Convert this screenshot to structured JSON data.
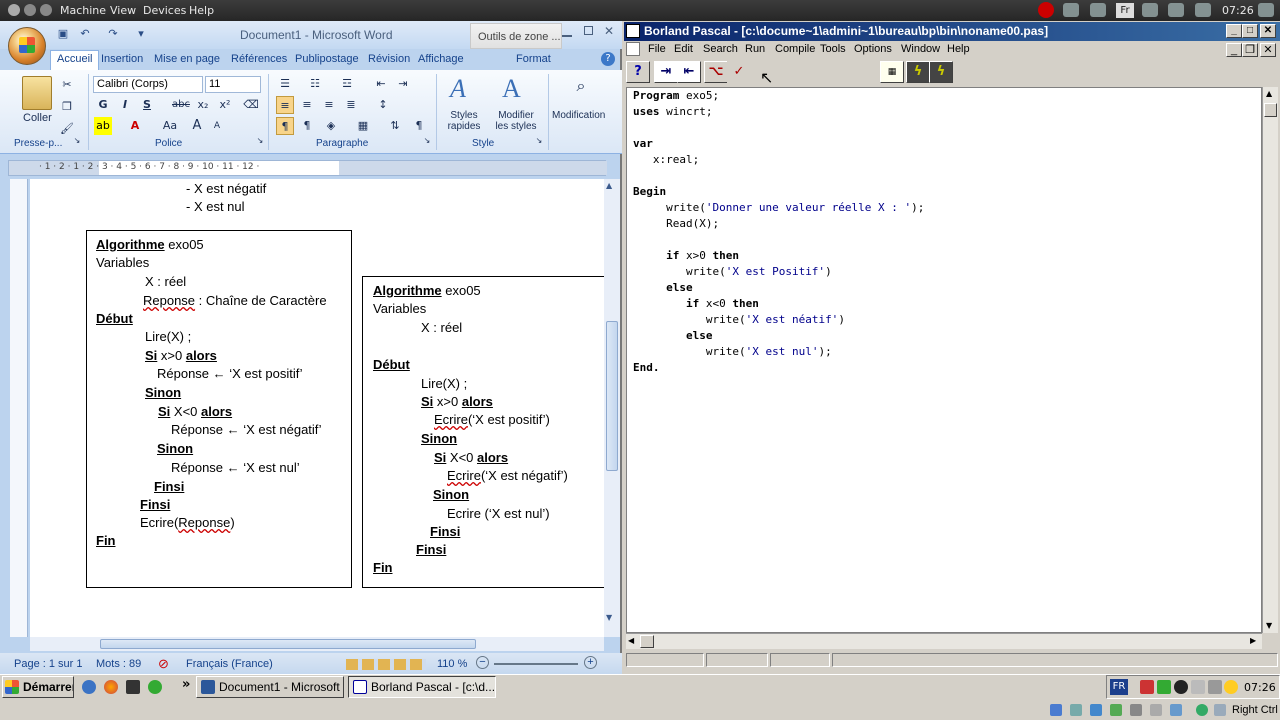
{
  "host_bar": {
    "menu": [
      "Machine",
      "View",
      "Devices",
      "Help"
    ],
    "lang": "Fr",
    "clock": "07:26"
  },
  "word": {
    "title": "Document1 - Microsoft Word",
    "context_tab": "Outils de zone ...",
    "tabs": [
      "Accueil",
      "Insertion",
      "Mise en page",
      "Références",
      "Publipostage",
      "Révision",
      "Affichage",
      "Format"
    ],
    "font_name": "Calibri (Corps)",
    "font_size": "11",
    "buttons": {
      "paste": "Coller",
      "styles1": "Styles",
      "styles2": "rapides",
      "modify1": "Modifier",
      "modify2": "les styles",
      "editing": "Modification",
      "bold": "G",
      "italic": "I",
      "strike": "abc",
      "sub": "x₂",
      "sup": "x²",
      "underline": "S",
      "pilcrow": "¶",
      "font_color": "A",
      "case": "Aa",
      "grow": "A",
      "shrink": "A"
    },
    "groups": [
      "Presse-p...",
      "Police",
      "Paragraphe",
      "Style"
    ],
    "ruler_numbers": "· 1 · 2 · 1 · 2 · 3 · 4 · 5 · 6 · 7 · 8 · 9 · 10 · 11 · 12 ·",
    "doc": {
      "top": [
        "- X est négatif",
        "- X est nul"
      ],
      "left": {
        "alg_kw": "Algorithme",
        "alg_name": " exo05",
        "variables": "Variables",
        "x_decl": "X : réel",
        "rep_name": "Reponse",
        "rep_type": " : Chaîne de Caractère",
        "debut": "Début",
        "lire": "Lire(X) ;",
        "si": "Si",
        "cond1": " x>0 ",
        "alors": "alors",
        "rep1": "Réponse  ←  ‘X est positif’",
        "sinon": "Sinon",
        "cond2": " X<0 ",
        "rep2": "Réponse  ←  ‘X est négatif’",
        "rep3": "Réponse  ←  ‘X est nul’",
        "finsi": "Finsi",
        "ecrire_kw": "Ecrire(",
        "ecrire_arg": "Reponse",
        "ecrire_end": ")",
        "fin": "Fin"
      },
      "right": {
        "alg_kw": "Algorithme",
        "alg_name": " exo05",
        "variables": "Variables",
        "x_decl": "X : réel",
        "debut": "Début",
        "lire": "Lire(X) ;",
        "si": "Si",
        "cond1": " x>0 ",
        "alors": "alors",
        "ecrire": "Ecrire",
        "arg1": "(‘X est positif’)",
        "sinon": "Sinon",
        "cond2": " X<0 ",
        "arg2": "(‘X est négatif’)",
        "ecrire3": "Ecrire (‘X est nul’)",
        "finsi": "Finsi",
        "fin": "Fin"
      }
    },
    "status": {
      "page": "Page : 1 sur 1",
      "words": "Mots : 89",
      "language": "Français (France)",
      "zoom": "110 %"
    }
  },
  "pascal": {
    "title": "Borland Pascal - [c:\\docume~1\\admini~1\\bureau\\bp\\bin\\noname00.pas]",
    "menu": [
      "File",
      "Edit",
      "Search",
      "Run",
      "Compile",
      "Tools",
      "Options",
      "Window",
      "Help"
    ],
    "toolbar_help": "?",
    "code": {
      "l1a": "Program",
      "l1b": " exo5;",
      "l2a": "uses",
      "l2b": " wincrt;",
      "l3": "var",
      "l4": "   x:real;",
      "l5": "Begin",
      "l6a": "     write(",
      "l6s": "'Donner une valeur réelle X : '",
      "l6b": ");",
      "l7": "     Read(X);",
      "l8a": "     if",
      "l8b": " x>0 ",
      "l8c": "then",
      "l9a": "        write(",
      "l9s": "'X est Positif'",
      "l9b": ")",
      "l10": "     else",
      "l11a": "        if",
      "l11b": " x<0 ",
      "l11c": "then",
      "l12a": "           write(",
      "l12s": "'X est néatif'",
      "l12b": ")",
      "l13": "        else",
      "l14a": "           write(",
      "l14s": "'X est nul'",
      "l14b": ");",
      "l15": "End."
    }
  },
  "taskbar": {
    "start": "Démarrer",
    "arrow": "»",
    "task1": "Document1 - Microsoft ...",
    "task2": "Borland Pascal - [c:\\d...",
    "lang": "FR",
    "clock": "07:26",
    "right_ctrl": "Right Ctrl"
  }
}
